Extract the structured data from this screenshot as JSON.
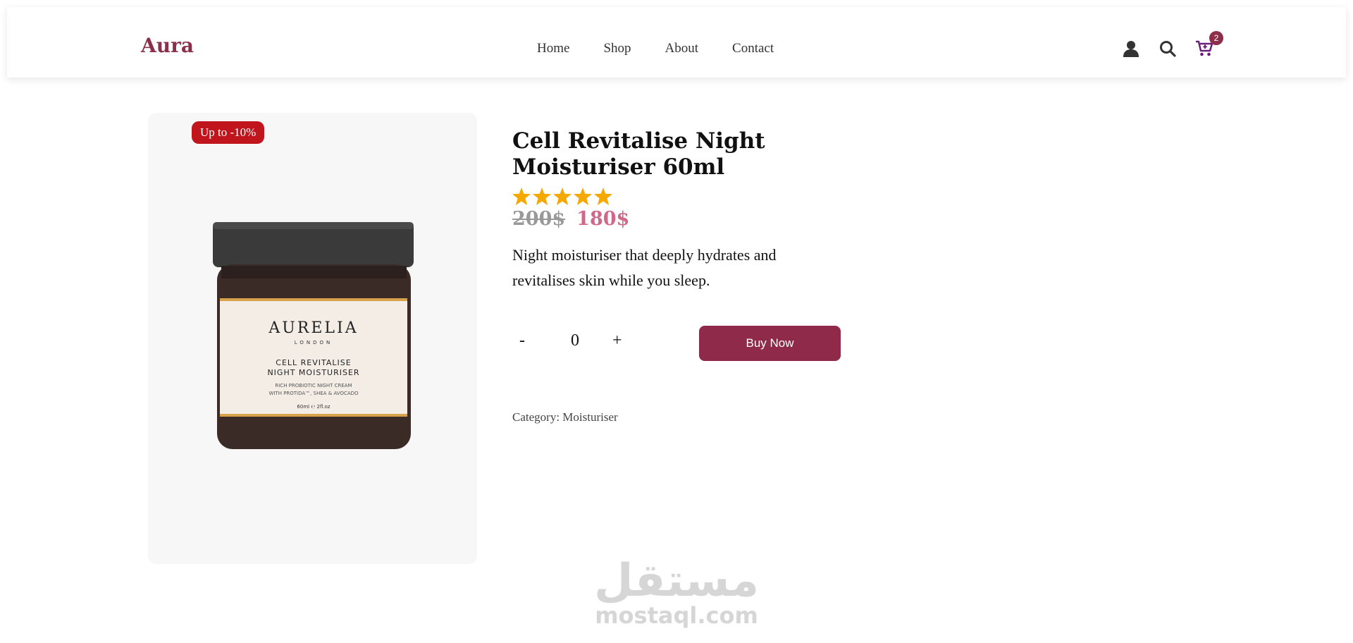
{
  "header": {
    "logo": "Aura",
    "nav": [
      "Home",
      "Shop",
      "About",
      "Contact"
    ],
    "icons": [
      "user-icon",
      "search-icon",
      "cart-icon"
    ],
    "cart_count": "2"
  },
  "product": {
    "discount_badge": "Up to -10%",
    "image_brand": "AURELIA",
    "image_sub": "LONDON",
    "image_line1": "CELL REVITALISE",
    "image_line2": "NIGHT MOISTURISER",
    "image_line3": "RICH PROBIOTIC NIGHT CREAM",
    "image_line4": "WITH PROTIDA™, SHEA & AVOCADO",
    "image_line5": "60ml ℮ 2fl.oz",
    "title": "Cell Revitalise Night Moisturiser 60ml",
    "rating": 5,
    "old_price": "200$",
    "new_price": "180$",
    "description": "Night moisturiser that deeply hydrates and revitalises skin while you sleep.",
    "qty_minus": "-",
    "qty_value": "0",
    "qty_plus": "+",
    "buy_label": "Buy Now",
    "category": "Category: Moisturiser"
  },
  "watermark": {
    "arabic": "مستقل",
    "latin": "mostaql.com"
  },
  "colors": {
    "brand": "#8c2f4a",
    "button": "#8f2a4b",
    "badge": "#c0151c",
    "star": "#f5a800",
    "new_price": "#d0688a"
  }
}
